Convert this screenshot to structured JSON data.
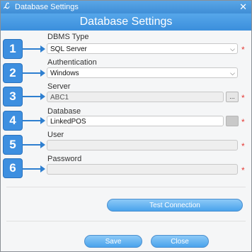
{
  "window": {
    "title": "Database Settings",
    "close_glyph": "✕"
  },
  "header": {
    "title": "Database Settings"
  },
  "fields": {
    "dbms": {
      "label": "DBMS Type",
      "value": "SQL Server"
    },
    "auth": {
      "label": "Authentication",
      "value": "Windows"
    },
    "server": {
      "label": "Server",
      "value": "ABC1",
      "browse": "..."
    },
    "database": {
      "label": "Database",
      "value": "LinkedPOS",
      "browse": "..."
    },
    "user": {
      "label": "User",
      "value": ""
    },
    "password": {
      "label": "Password",
      "value": ""
    }
  },
  "required_mark": "*",
  "badges": [
    "1",
    "2",
    "3",
    "4",
    "5",
    "6"
  ],
  "buttons": {
    "test": "Test Connection",
    "save": "Save",
    "close": "Close"
  },
  "colors": {
    "accent": "#3d8fe0",
    "required": "#e53935"
  }
}
